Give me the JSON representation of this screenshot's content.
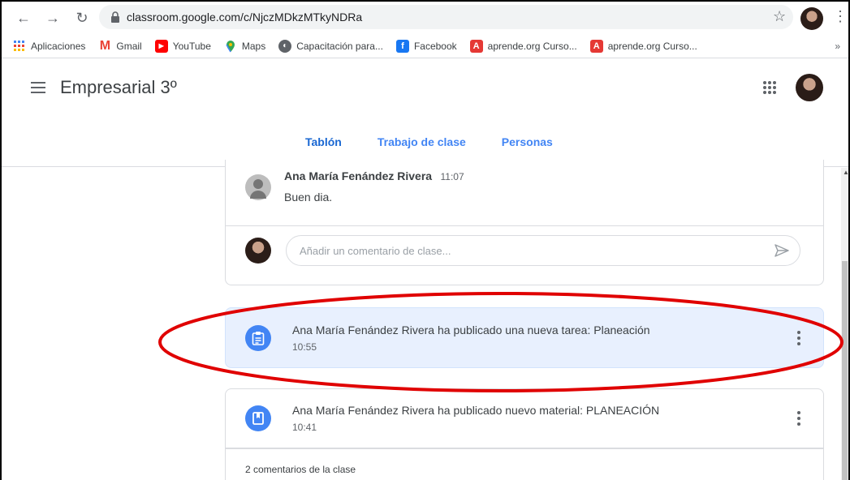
{
  "browser": {
    "url": "classroom.google.com/c/NjczMDkzMTkyNDRa",
    "bookmarks": [
      {
        "label": "Aplicaciones",
        "icon": "apps-grid-icon",
        "color": "#4285f4"
      },
      {
        "label": "Gmail",
        "icon": "gmail-icon",
        "color": "#ea4335"
      },
      {
        "label": "YouTube",
        "icon": "youtube-icon",
        "color": "#ff0000"
      },
      {
        "label": "Maps",
        "icon": "maps-icon",
        "color": "#34a853"
      },
      {
        "label": "Capacitación para...",
        "icon": "globe-icon",
        "color": "#5f6368"
      },
      {
        "label": "Facebook",
        "icon": "facebook-icon",
        "color": "#1877f2"
      },
      {
        "label": "aprende.org Curso...",
        "icon": "aprende-icon",
        "color": "#e53935"
      },
      {
        "label": "aprende.org Curso...",
        "icon": "aprende-icon",
        "color": "#e53935"
      }
    ],
    "more": "»"
  },
  "header": {
    "title": "Empresarial 3º",
    "tabs": [
      {
        "label": "Tablón",
        "active": true
      },
      {
        "label": "Trabajo de clase",
        "active": false
      },
      {
        "label": "Personas",
        "active": false
      }
    ]
  },
  "stream": {
    "comment": {
      "author": "Ana María Fenández Rivera",
      "time": "11:07",
      "text": "Buen dia."
    },
    "add_comment_placeholder": "Añadir un comentario de clase...",
    "posts": [
      {
        "title": "Ana María Fenández Rivera ha publicado una nueva tarea: Planeación",
        "time": "10:55",
        "icon": "assignment-icon"
      },
      {
        "title": "Ana María Fenández Rivera ha publicado nuevo material: PLANEACIÓN",
        "time": "10:41",
        "icon": "material-icon"
      }
    ],
    "class_comments": "2 comentarios de la clase"
  },
  "colors": {
    "accent": "#1967d2",
    "highlight_bg": "#e8f0fe",
    "annotation": "#e00000"
  }
}
